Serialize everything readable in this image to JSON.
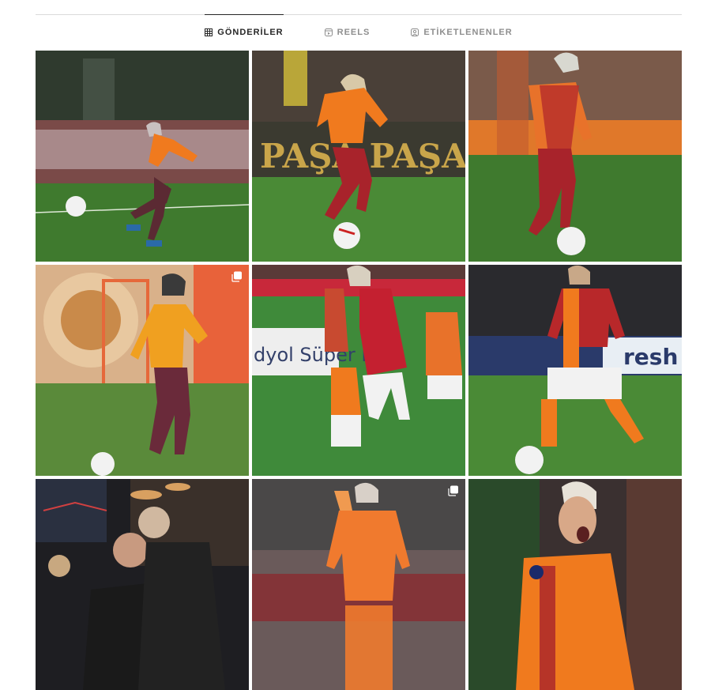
{
  "tabs": [
    {
      "label": "GÖNDERİLER",
      "icon": "grid-icon",
      "active": true
    },
    {
      "label": "REELS",
      "icon": "reels-icon",
      "active": false
    },
    {
      "label": "ETİKETLENENLER",
      "icon": "tagged-icon",
      "active": false
    }
  ],
  "posts": [
    {
      "subject": "player-training-kick",
      "multiple": false,
      "banner_text": ""
    },
    {
      "subject": "player-dribbling-orange-kit",
      "multiple": false,
      "banner_text": "PAŞA PAŞA"
    },
    {
      "subject": "player-running-red-orange-kit",
      "multiple": false,
      "banner_text": ""
    },
    {
      "subject": "player-training-winter-hat",
      "multiple": true,
      "banner_text": ""
    },
    {
      "subject": "player-with-children",
      "multiple": false,
      "banner_text": "dyol Süper L"
    },
    {
      "subject": "player-dribbling-white-shorts",
      "multiple": false,
      "banner_text": "resh"
    },
    {
      "subject": "player-selfie-with-friend",
      "multiple": false,
      "banner_text": ""
    },
    {
      "subject": "player-pointing-orange-kit",
      "multiple": true,
      "banner_text": ""
    },
    {
      "subject": "player-celebrating",
      "multiple": false,
      "banner_text": ""
    }
  ],
  "colors": {
    "active_tab": "#262626",
    "inactive_tab": "#8e8e8e",
    "divider": "#dbdbdb",
    "kit_orange": "#f07a1e",
    "kit_red": "#a8232b",
    "pitch_green": "#3f7a2e"
  }
}
